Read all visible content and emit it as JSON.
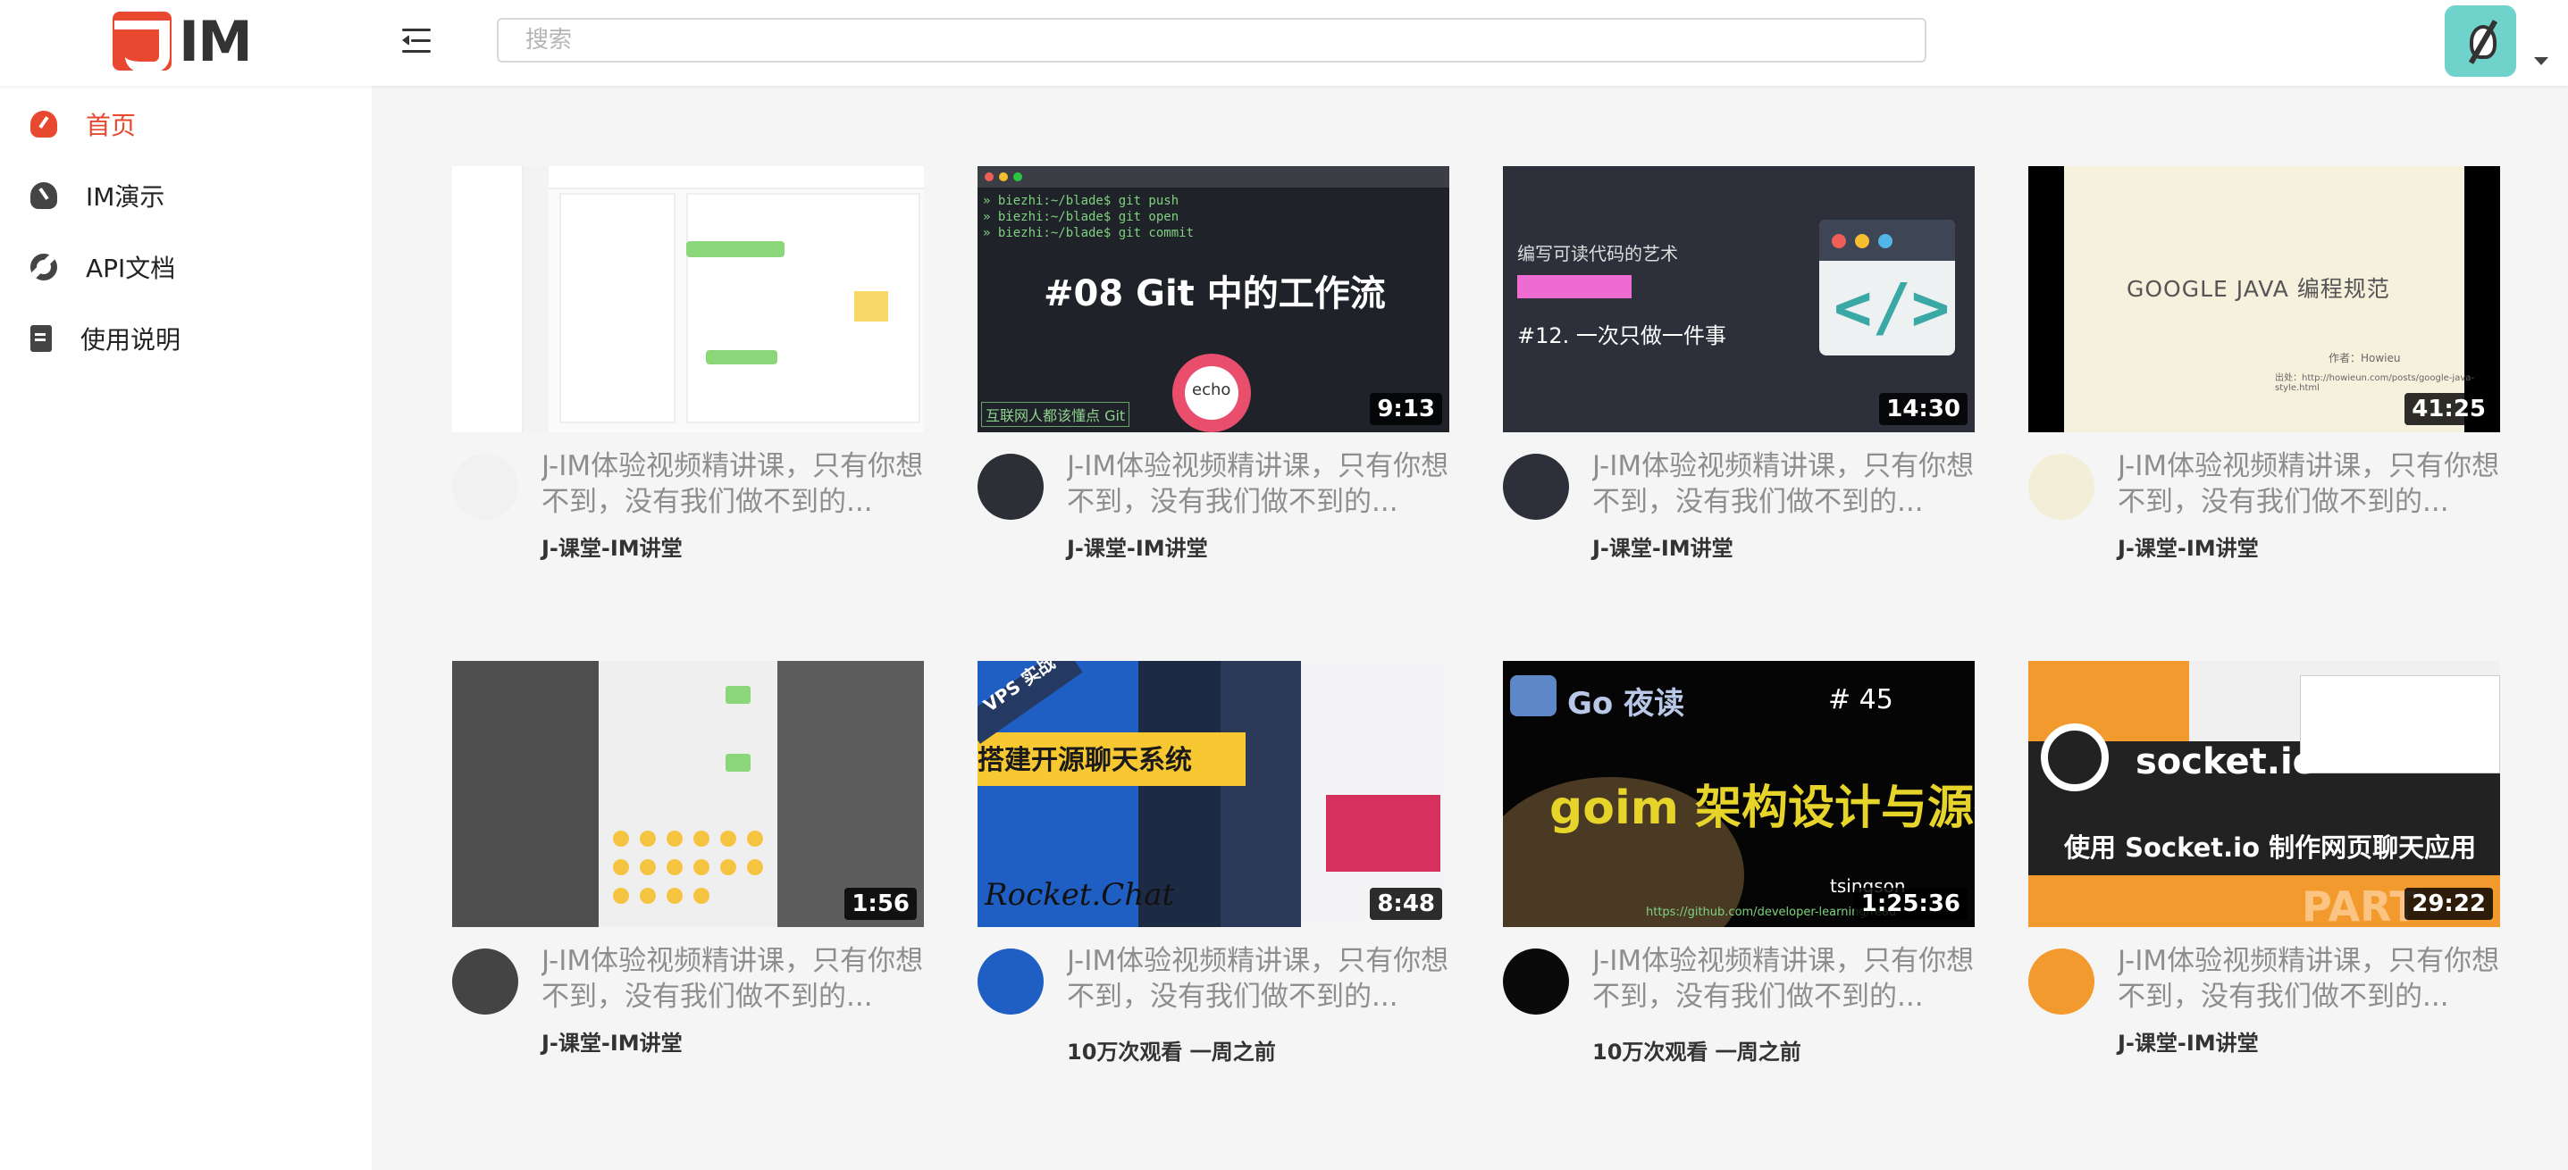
{
  "header": {
    "logo_text": "IM",
    "search_placeholder": "搜索"
  },
  "sidebar": {
    "items": [
      {
        "label": "首页",
        "active": true
      },
      {
        "label": "IM演示",
        "active": false
      },
      {
        "label": "API文档",
        "active": false
      },
      {
        "label": "使用说明",
        "active": false
      }
    ]
  },
  "colors": {
    "accent": "#e8482f",
    "background": "#f5f5f5",
    "avatar": "#6fd3cc"
  },
  "videos": [
    {
      "title": "J-IM体验视频精讲课，只有你想不到，没有我们做不到的...",
      "subtitle": "J-课堂-IM讲堂",
      "duration": "",
      "thumb_text": []
    },
    {
      "title": "J-IM体验视频精讲课，只有你想不到，没有我们做不到的...",
      "subtitle": "J-课堂-IM讲堂",
      "duration": "9:13",
      "thumb_text": [
        "» biezhi:~/blade$ git push",
        "» biezhi:~/blade$ git open",
        "» biezhi:~/blade$ git commit",
        "#08 Git 中的工作流",
        "互联网人都该懂点 Git",
        "echo"
      ]
    },
    {
      "title": "J-IM体验视频精讲课，只有你想不到，没有我们做不到的...",
      "subtitle": "J-课堂-IM讲堂",
      "duration": "14:30",
      "thumb_text": [
        "编写可读代码的艺术",
        "#12. 一次只做一件事",
        "</>"
      ]
    },
    {
      "title": "J-IM体验视频精讲课，只有你想不到，没有我们做不到的...",
      "subtitle": "J-课堂-IM讲堂",
      "duration": "41:25",
      "thumb_text": [
        "GOOGLE JAVA 编程规范",
        "作者：Howieu",
        "出处：http://howieun.com/posts/google-java-style.html"
      ]
    },
    {
      "title": "J-IM体验视频精讲课，只有你想不到，没有我们做不到的...",
      "subtitle": "J-课堂-IM讲堂",
      "duration": "1:56",
      "thumb_text": []
    },
    {
      "title": "J-IM体验视频精讲课，只有你想不到，没有我们做不到的...",
      "subtitle": "10万次观看  一周之前",
      "duration": "8:48",
      "thumb_text": [
        "VPS 实战",
        "搭建开源聊天系统",
        "Rocket.Chat"
      ]
    },
    {
      "title": "J-IM体验视频精讲课，只有你想不到，没有我们做不到的...",
      "subtitle": "10万次观看  一周之前",
      "duration": "1:25:36",
      "thumb_text": [
        "Go 夜读",
        "# 45",
        "goim 架构设计与源码分析",
        "tsingson",
        "https://github.com/developer-learning/read"
      ]
    },
    {
      "title": "J-IM体验视频精讲课，只有你想不到，没有我们做不到的...",
      "subtitle": "J-课堂-IM讲堂",
      "duration": "29:22",
      "thumb_text": [
        "socket.io",
        "使用 Socket.io 制作网页聊天应用",
        "PART"
      ]
    }
  ]
}
